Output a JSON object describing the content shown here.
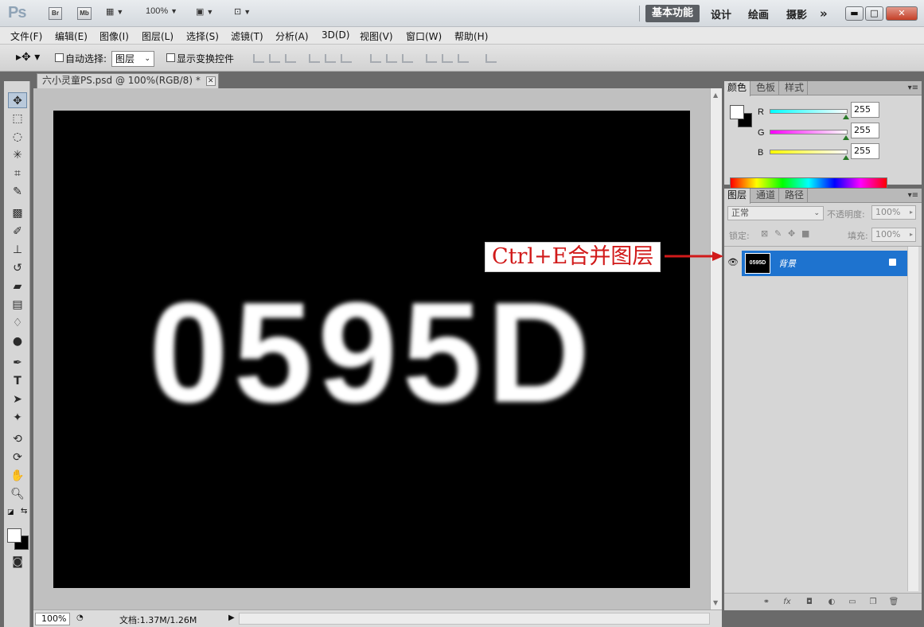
{
  "app": {
    "logo": "Ps",
    "bridge_label": "Br",
    "minibridge_label": "Mb",
    "zoom_level": "100%",
    "workspaces": [
      "基本功能",
      "设计",
      "绘画",
      "摄影"
    ],
    "more_label": "»"
  },
  "menu": [
    "文件(F)",
    "编辑(E)",
    "图像(I)",
    "图层(L)",
    "选择(S)",
    "滤镜(T)",
    "分析(A)",
    "3D(D)",
    "视图(V)",
    "窗口(W)",
    "帮助(H)"
  ],
  "options": {
    "auto_select_label": "自动选择:",
    "auto_select_value": "图层",
    "show_transform_label": "显示变换控件"
  },
  "document": {
    "tab_title": "六小灵童PS.psd @ 100%(RGB/8) *",
    "canvas_text": "0595D",
    "zoom": "100%",
    "doc_info": "文档:1.37M/1.26M"
  },
  "color_panel": {
    "tabs": [
      "颜色",
      "色板",
      "样式"
    ],
    "channels": [
      {
        "label": "R",
        "value": "255",
        "gradient": "#00ffff"
      },
      {
        "label": "G",
        "value": "255",
        "gradient": "#ff00ff"
      },
      {
        "label": "B",
        "value": "255",
        "gradient": "#ffff00"
      }
    ],
    "foreground": "#ffffff",
    "background": "#000000"
  },
  "layers_panel": {
    "tabs": [
      "图层",
      "通道",
      "路径"
    ],
    "blend_mode": "正常",
    "opacity_label": "不透明度:",
    "opacity_value": "100%",
    "lock_label": "锁定:",
    "fill_label": "填充:",
    "fill_value": "100%",
    "layers": [
      {
        "name": "背景",
        "thumb_text": "0595D",
        "visible": true,
        "locked": true
      }
    ]
  },
  "annotation": {
    "text": "Ctrl+E合并图层",
    "color": "#d11a1a"
  }
}
